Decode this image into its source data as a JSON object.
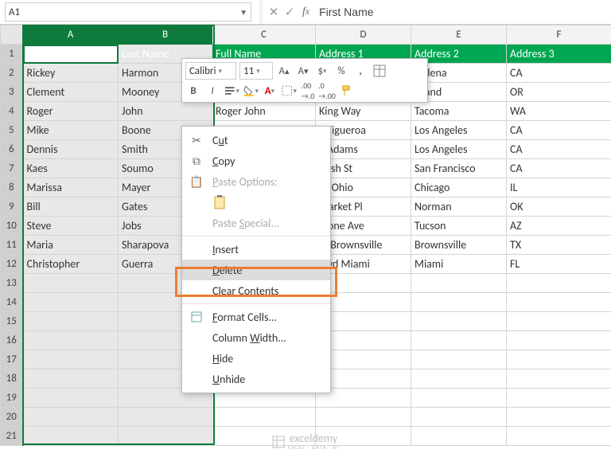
{
  "namebox": {
    "ref": "A1"
  },
  "formula_bar": {
    "value": "First Name"
  },
  "columns": [
    "A",
    "B",
    "C",
    "D",
    "E",
    "F"
  ],
  "selectedCols": [
    "A",
    "B"
  ],
  "headers": [
    "First Name",
    "Last Name",
    "Full Name",
    "Address 1",
    "Address 2",
    "Address 3"
  ],
  "rows": [
    [
      "Rickey",
      "Harmon",
      "",
      "",
      "sadena",
      "CA"
    ],
    [
      "Clement",
      "Mooney",
      "",
      "",
      "rtland",
      "OR"
    ],
    [
      "Roger",
      "John",
      "Roger John",
      "King Way",
      "Tacoma",
      "WA"
    ],
    [
      "Mike",
      "Boone",
      "",
      "S Figueroa",
      "Los Angeles",
      "CA"
    ],
    [
      "Dennis",
      "Smith",
      "",
      "E Adams",
      "Los Angeles",
      "CA"
    ],
    [
      "Kaes",
      "Soumo",
      "",
      "Bush St",
      "San Francisco",
      "CA"
    ],
    [
      "Marissa",
      "Mayer",
      "",
      "W Ohio",
      "Chicago",
      "IL"
    ],
    [
      "Bill",
      "Gates",
      "",
      "Market Pl",
      "Norman",
      "OK"
    ],
    [
      "Steve",
      "Jobs",
      "",
      "Stone Ave",
      "Tucson",
      "AZ"
    ],
    [
      "Maria",
      "Sharapova",
      "",
      "St Brownsville",
      "Brownsville",
      "TX"
    ],
    [
      "Christopher",
      "Guerra",
      "",
      "Blvd Miami",
      "Miami",
      "FL"
    ]
  ],
  "emptyRows": 9,
  "mini_toolbar": {
    "font": "Calibri",
    "size": "11"
  },
  "context_menu": {
    "cut": "Cut",
    "copy": "Copy",
    "paste_opt": "Paste Options:",
    "paste_special": "Paste Special...",
    "insert": "Insert",
    "delete": "Delete",
    "clear": "Clear Contents",
    "format": "Format Cells...",
    "colwidth": "Column Width...",
    "hide": "Hide",
    "unhide": "Unhide"
  },
  "watermark": {
    "text": "exceldemy",
    "sub": "EXCEL · DATA · BI"
  }
}
